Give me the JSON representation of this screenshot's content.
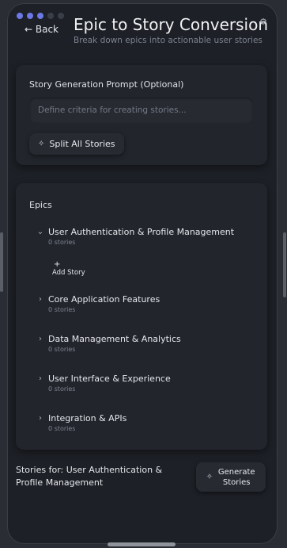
{
  "header": {
    "back_label": "← Back",
    "title": "Epic to Story Conversion",
    "subtitle": "Break down epics into actionable user stories"
  },
  "progress": {
    "total_steps": 5,
    "completed_steps": 3,
    "active_color": "#6b78e6"
  },
  "prompt_card": {
    "label": "Story Generation Prompt (Optional)",
    "placeholder": "Define criteria for creating stories...",
    "value": "",
    "split_button_label": "Split All Stories",
    "split_button_icon": "sparkle-icon"
  },
  "epics_card": {
    "title": "Epics",
    "add_story_plus": "+",
    "add_story_label": "Add Story",
    "items": [
      {
        "name": "User Authentication & Profile Management",
        "count": "0 stories",
        "expanded": true
      },
      {
        "name": "Core Application Features",
        "count": "0 stories",
        "expanded": false
      },
      {
        "name": "Data Management & Analytics",
        "count": "0 stories",
        "expanded": false
      },
      {
        "name": "User Interface & Experience",
        "count": "0 stories",
        "expanded": false
      },
      {
        "name": "Integration & APIs",
        "count": "0 stories",
        "expanded": false
      }
    ]
  },
  "footer": {
    "stories_for": "Stories for: User Authentication & Profile Management",
    "generate_label": "Generate Stories",
    "generate_icon": "sparkle-icon"
  }
}
